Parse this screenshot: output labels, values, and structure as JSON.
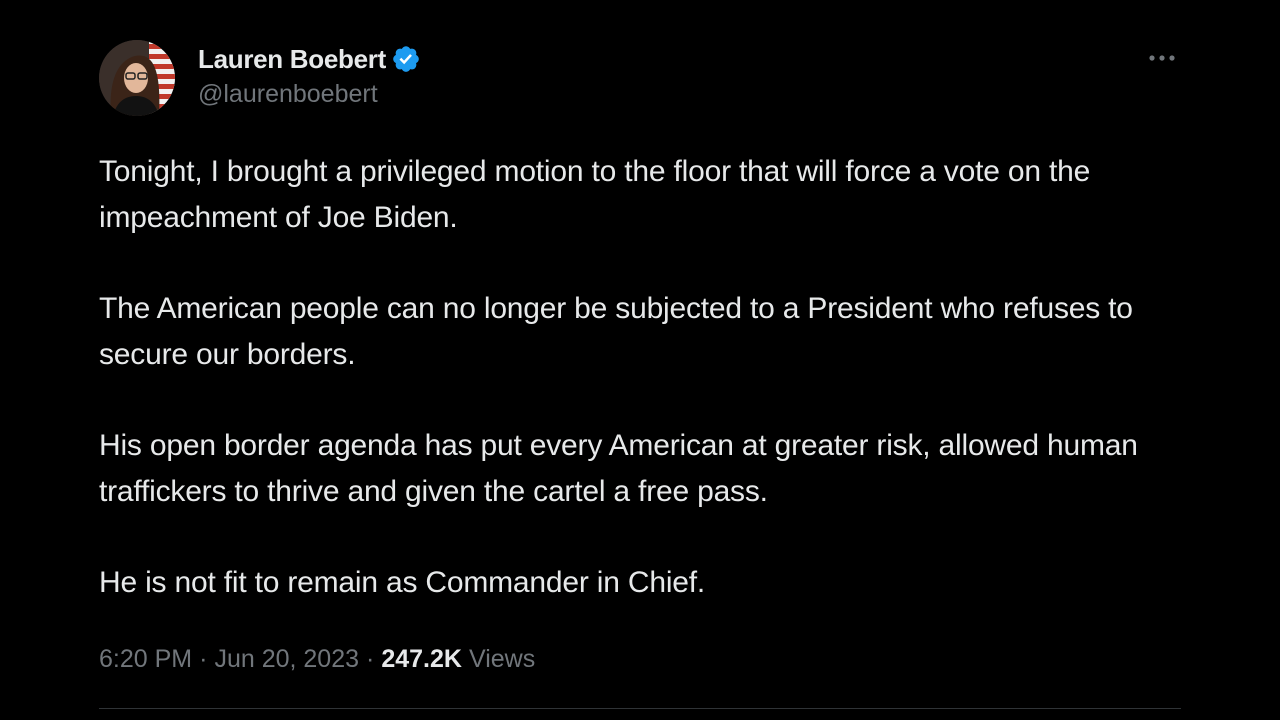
{
  "tweet": {
    "author": {
      "display_name": "Lauren Boebert",
      "handle": "@laurenboebert",
      "verified": true,
      "avatar_icon": "profile-photo-avatar",
      "verified_icon": "verified-badge-icon"
    },
    "menu_icon": "more-options-icon",
    "paragraphs": [
      "Tonight, I brought a privileged motion to the floor that will force a vote on the impeachment of Joe Biden.",
      "The American people can no longer be subjected to a President who refuses to secure our borders.",
      "His open border agenda has put every American at greater risk, allowed human traffickers to thrive and given the cartel a free pass.",
      "He is not fit to remain as Commander in Chief."
    ],
    "meta": {
      "time": "6:20 PM",
      "separator": "·",
      "date": "Jun 20, 2023",
      "views_count": "247.2K",
      "views_label": "Views"
    }
  },
  "colors": {
    "background": "#000000",
    "primary_text": "#e7e9ea",
    "secondary_text": "#71767b",
    "verified_blue": "#1d9bf0",
    "divider": "#2f3336"
  }
}
